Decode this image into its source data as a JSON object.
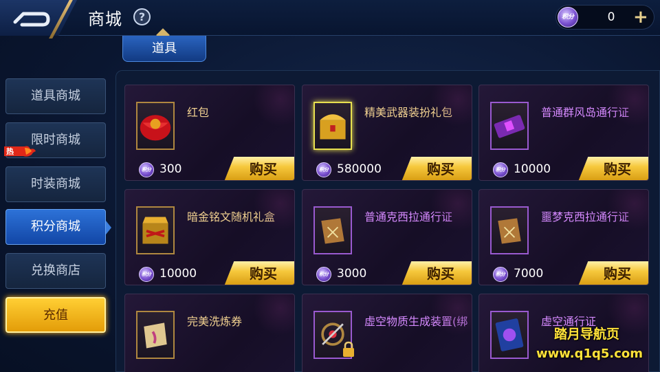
{
  "header": {
    "title": "商城",
    "help_icon": "question-icon",
    "currency": {
      "icon": "points-coin-icon",
      "icon_label": "积分",
      "value": "0",
      "plus_label": "+"
    }
  },
  "tabs": [
    {
      "label": "道具",
      "active": true
    }
  ],
  "sidebar": {
    "items": [
      {
        "label": "道具商城",
        "active": false
      },
      {
        "label": "限时商城",
        "active": false,
        "badge": "热"
      },
      {
        "label": "时装商城",
        "active": false
      },
      {
        "label": "积分商城",
        "active": true
      },
      {
        "label": "兑换商店",
        "active": false
      },
      {
        "label": "充值",
        "active": false
      }
    ]
  },
  "shop": {
    "buy_label": "购买",
    "price_icon_label": "积分",
    "items": [
      {
        "name": "红包",
        "price": "300",
        "icon": "red-envelope-icon",
        "name_color": "gold"
      },
      {
        "name": "精美武器装扮礼包",
        "price": "580000",
        "icon": "treasure-chest-icon",
        "name_color": "gold"
      },
      {
        "name": "普通群风岛通行证",
        "price": "10000",
        "icon": "ticket-icon",
        "name_color": "purple"
      },
      {
        "name": "暗金铭文随机礼盒",
        "price": "10000",
        "icon": "gold-box-icon",
        "name_color": "gold"
      },
      {
        "name": "普通克西拉通行证",
        "price": "3000",
        "icon": "scroll-icon",
        "name_color": "purple"
      },
      {
        "name": "噩梦克西拉通行证",
        "price": "7000",
        "icon": "scroll-icon",
        "name_color": "purple"
      },
      {
        "name": "完美洗炼券",
        "price": "",
        "icon": "scroll-icon",
        "name_color": "gold"
      },
      {
        "name": "虚空物质生成装置(绑",
        "price": "",
        "icon": "void-device-icon",
        "name_color": "purple"
      },
      {
        "name": "虚空通行证",
        "price": "",
        "icon": "void-card-icon",
        "name_color": "purple"
      }
    ]
  },
  "watermark": {
    "line1": "踏月导航页",
    "line2": "www.q1q5.com"
  },
  "colors": {
    "gold_text": "#f0d090",
    "purple_text": "#d68aff",
    "buy_button": "#f6c83c",
    "active_blue": "#2d72d8",
    "recharge": "#ffcf34"
  }
}
